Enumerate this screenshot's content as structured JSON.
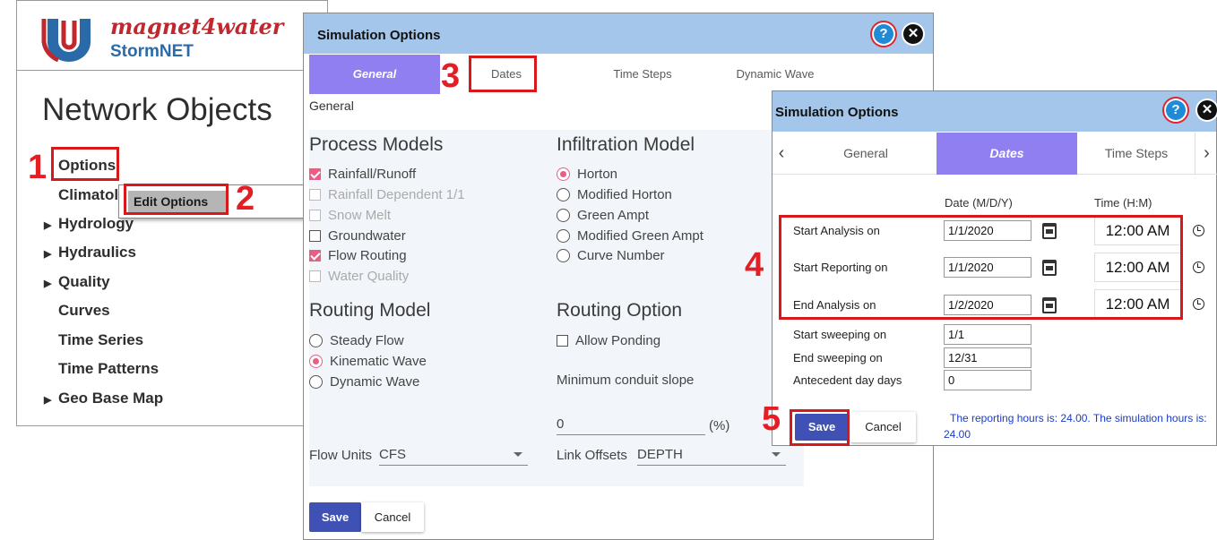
{
  "brand": {
    "name": "magnet4water",
    "product": "StormNET"
  },
  "left_panel": {
    "title": "Network Objects",
    "items": [
      {
        "label": "Options",
        "caret": false
      },
      {
        "label": "Climatology",
        "caret": false
      },
      {
        "label": "Hydrology",
        "caret": true
      },
      {
        "label": "Hydraulics",
        "caret": true
      },
      {
        "label": "Quality",
        "caret": true
      },
      {
        "label": "Curves",
        "caret": false
      },
      {
        "label": "Time Series",
        "caret": false
      },
      {
        "label": "Time Patterns",
        "caret": false
      },
      {
        "label": "Geo Base Map",
        "caret": true
      }
    ],
    "context_menu": {
      "edit_options": "Edit Options"
    }
  },
  "steps": [
    "1",
    "2",
    "3",
    "4",
    "5"
  ],
  "dialog_general": {
    "title": "Simulation Options",
    "help_icon": "?",
    "close_icon": "✕",
    "tabs": [
      "General",
      "Dates",
      "Time Steps",
      "Dynamic Wave"
    ],
    "active_tab": "General",
    "section_label": "General",
    "process_models": {
      "heading": "Process Models",
      "options": [
        {
          "label": "Rainfall/Runoff",
          "checked": true,
          "disabled": false
        },
        {
          "label": "Rainfall Dependent 1/1",
          "checked": false,
          "disabled": true
        },
        {
          "label": "Snow Melt",
          "checked": false,
          "disabled": true
        },
        {
          "label": "Groundwater",
          "checked": false,
          "disabled": false
        },
        {
          "label": "Flow Routing",
          "checked": true,
          "disabled": false
        },
        {
          "label": "Water Quality",
          "checked": false,
          "disabled": true
        }
      ]
    },
    "infiltration_model": {
      "heading": "Infiltration Model",
      "options": [
        "Horton",
        "Modified Horton",
        "Green Ampt",
        "Modified Green Ampt",
        "Curve Number"
      ],
      "selected": "Horton"
    },
    "routing_model": {
      "heading": "Routing Model",
      "options": [
        "Steady Flow",
        "Kinematic Wave",
        "Dynamic Wave"
      ],
      "selected": "Kinematic Wave"
    },
    "routing_option": {
      "heading": "Routing Option",
      "allow_ponding": "Allow Ponding",
      "allow_ponding_checked": false,
      "min_slope_label": "Minimum conduit slope",
      "min_slope_value": "0",
      "min_slope_unit": "(%)"
    },
    "flow_units": {
      "label": "Flow Units",
      "value": "CFS"
    },
    "link_offsets": {
      "label": "Link Offsets",
      "value": "DEPTH"
    },
    "buttons": {
      "save": "Save",
      "cancel": "Cancel"
    }
  },
  "dialog_dates": {
    "title": "Simulation Options",
    "help_icon": "?",
    "close_icon": "✕",
    "tabs": [
      "General",
      "Dates",
      "Time Steps"
    ],
    "active_tab": "Dates",
    "prev_icon": "‹",
    "next_icon": "›",
    "date_header": "Date (M/D/Y)",
    "time_header": "Time (H:M)",
    "rows": [
      {
        "label": "Start Analysis on",
        "date": "1/1/2020",
        "time": "12:00  AM"
      },
      {
        "label": "Start Reporting on",
        "date": "1/1/2020",
        "time": "12:00  AM"
      },
      {
        "label": "End Analysis on",
        "date": "1/2/2020",
        "time": "12:00  AM"
      }
    ],
    "sweep_rows": [
      {
        "label": "Start sweeping on",
        "value": "1/1"
      },
      {
        "label": "End sweeping on",
        "value": "12/31"
      },
      {
        "label": "Antecedent day days",
        "value": "0"
      }
    ],
    "buttons": {
      "save": "Save",
      "cancel": "Cancel"
    },
    "info": "The reporting hours is: 24.00. The simulation hours is: 24.00"
  },
  "colors": {
    "accent_red": "#e31e24",
    "tab_active": "#8f7ff0",
    "titlebar": "#a3c6ea",
    "save_button": "#3f51b5"
  }
}
